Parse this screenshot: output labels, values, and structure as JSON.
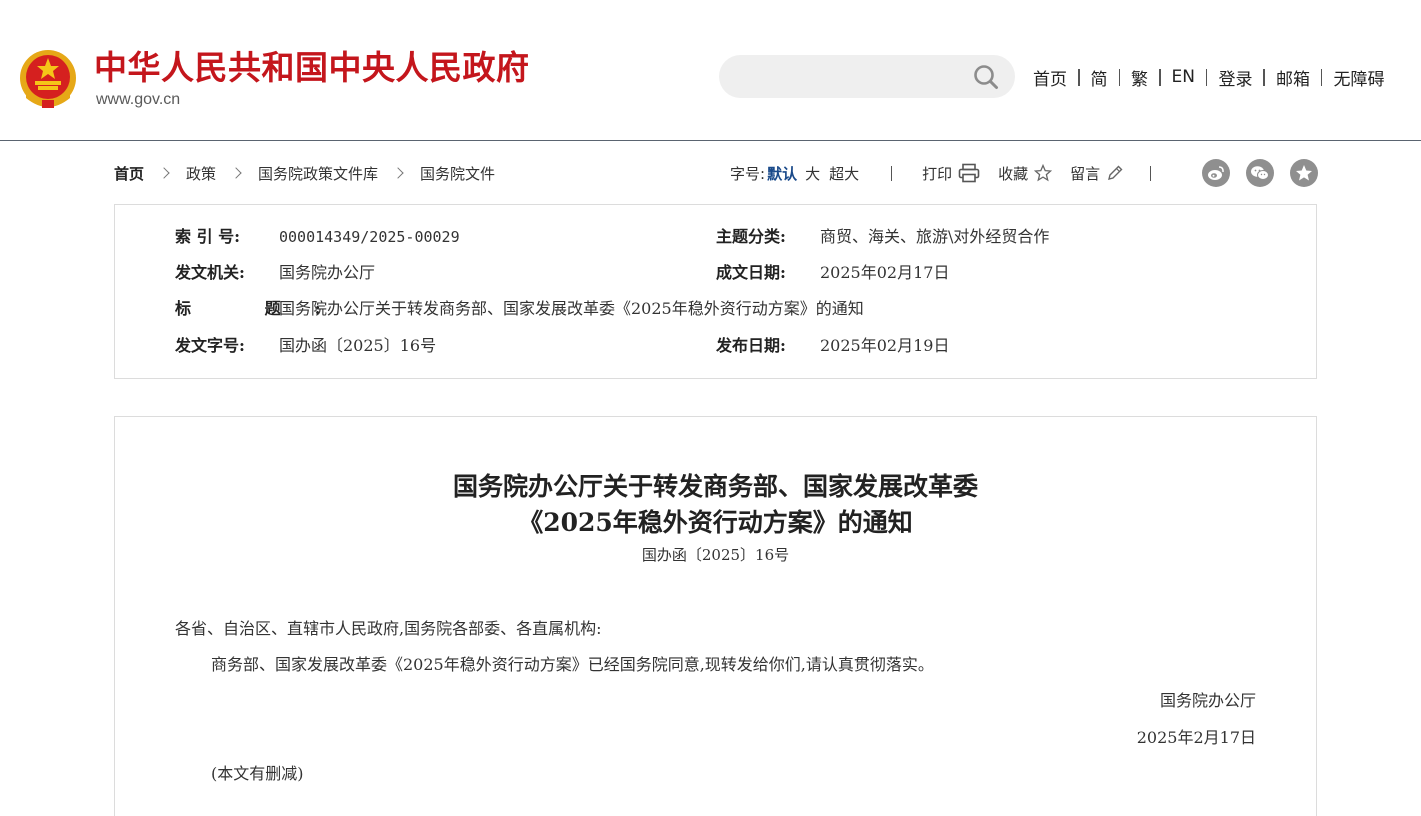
{
  "header": {
    "site_name": "中华人民共和国中央人民政府",
    "site_url": "www.gov.cn",
    "search_placeholder": "",
    "nav": [
      {
        "label": "首页"
      },
      {
        "label": "简"
      },
      {
        "label": "繁"
      },
      {
        "label": "EN"
      },
      {
        "label": "登录"
      },
      {
        "label": "邮箱"
      },
      {
        "label": "无障碍"
      }
    ]
  },
  "breadcrumb": [
    "首页",
    "政策",
    "国务院政策文件库",
    "国务院文件"
  ],
  "tools": {
    "font_size_label": "字号:",
    "font_default": "默认",
    "font_large": "大",
    "font_xlarge": "超大",
    "print": "打印",
    "favorite": "收藏",
    "comment": "留言"
  },
  "share_icons": [
    "weibo-icon",
    "wechat-icon",
    "qzone-star-icon"
  ],
  "meta": {
    "index_label": "索 引 号:",
    "index_value": "000014349/2025-00029",
    "topic_label": "主题分类:",
    "topic_value": "商贸、海关、旅游\\对外经贸合作",
    "issuer_label": "发文机关:",
    "issuer_value": "国务院办公厅",
    "written_date_label": "成文日期:",
    "written_date_value": "2025年02月17日",
    "title_label": "标 题:",
    "title_value": "国务院办公厅关于转发商务部、国家发展改革委《2025年稳外资行动方案》的通知",
    "docno_label": "发文字号:",
    "docno_value": "国办函〔2025〕16号",
    "publish_date_label": "发布日期:",
    "publish_date_value": "2025年02月19日"
  },
  "article": {
    "title_line1": "国务院办公厅关于转发商务部、国家发展改革委",
    "title_line2": "《2025年稳外资行动方案》的通知",
    "doc_number": "国办函〔2025〕16号",
    "addressee": "各省、自治区、直辖市人民政府,国务院各部委、各直属机构:",
    "body": "商务部、国家发展改革委《2025年稳外资行动方案》已经国务院同意,现转发给你们,请认真贯彻落实。",
    "signer": "国务院办公厅",
    "date": "2025年2月17日",
    "note": "(本文有删减)"
  },
  "colors": {
    "brand_red": "#c4161c",
    "link_blue": "#1a4a8a",
    "share_gray": "#8f8f8f"
  }
}
